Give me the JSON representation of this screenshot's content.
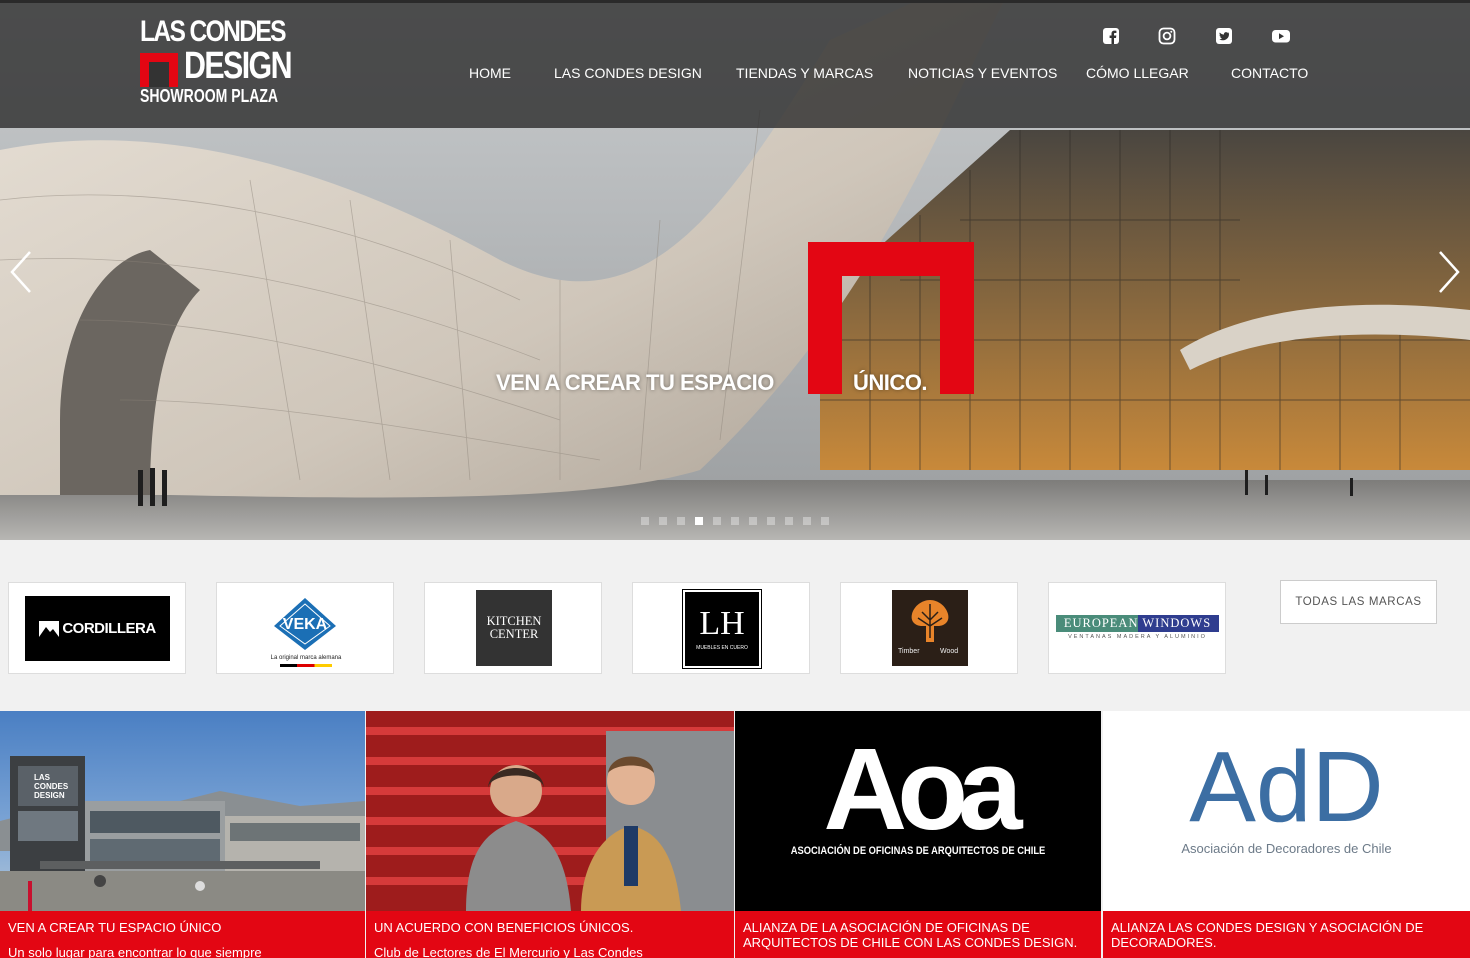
{
  "header": {
    "logo": {
      "line1": "LAS CONDES",
      "line2": "DESIGN",
      "line3": "SHOWROOM PLAZA"
    },
    "social": [
      {
        "icon": "facebook-icon"
      },
      {
        "icon": "instagram-icon"
      },
      {
        "icon": "twitter-icon"
      },
      {
        "icon": "youtube-icon"
      }
    ],
    "nav": [
      "HOME",
      "LAS CONDES DESIGN",
      "TIENDAS Y MARCAS",
      "NOTICIAS Y EVENTOS",
      "CÓMO LLEGAR",
      "CONTACTO"
    ]
  },
  "hero": {
    "text_left": "VEN A CREAR TU ESPACIO",
    "text_right": "ÚNICO.",
    "slide_count": 11,
    "active_slide": 4,
    "accent": "#e30613"
  },
  "brands": {
    "items": [
      {
        "name": "CORDILLERA"
      },
      {
        "name": "VEKA",
        "tagline": "La original marca alemana"
      },
      {
        "name": "KITCHEN",
        "name2": "CENTER"
      },
      {
        "name": "LH",
        "tagline": "MUEBLES EN CUERO"
      },
      {
        "name": "Timber",
        "name2": "Wood"
      },
      {
        "name": "EUROPEAN WINDOWS",
        "tagline": "VENTANAS MADERA Y ALUMINIO"
      }
    ],
    "all_label": "TODAS LAS MARCAS"
  },
  "news": [
    {
      "title": "VEN A CREAR TU ESPACIO ÚNICO",
      "snippet": "Un solo lugar para encontrar lo que siempre"
    },
    {
      "title": "UN ACUERDO CON BENEFICIOS ÚNICOS.",
      "snippet": "Club de Lectores de El Mercurio y Las Condes"
    },
    {
      "title": "ALIANZA DE LA ASOCIACIÓN DE OFICINAS DE ARQUITECTOS DE CHILE CON LAS CONDES DESIGN.",
      "snippet": ""
    },
    {
      "title": "ALIANZA LAS CONDES DESIGN Y ASOCIACIÓN DE DECORADORES.",
      "snippet": ""
    }
  ],
  "news_images": {
    "building_logo": "LAS CONDES DESIGN",
    "aoa": "Aoa",
    "aoa_sub": "ASOCIACIÓN DE OFICINAS DE ARQUITECTOS DE CHILE",
    "add": "AdD",
    "add_sub": "Asociación de Decoradores de Chile"
  }
}
